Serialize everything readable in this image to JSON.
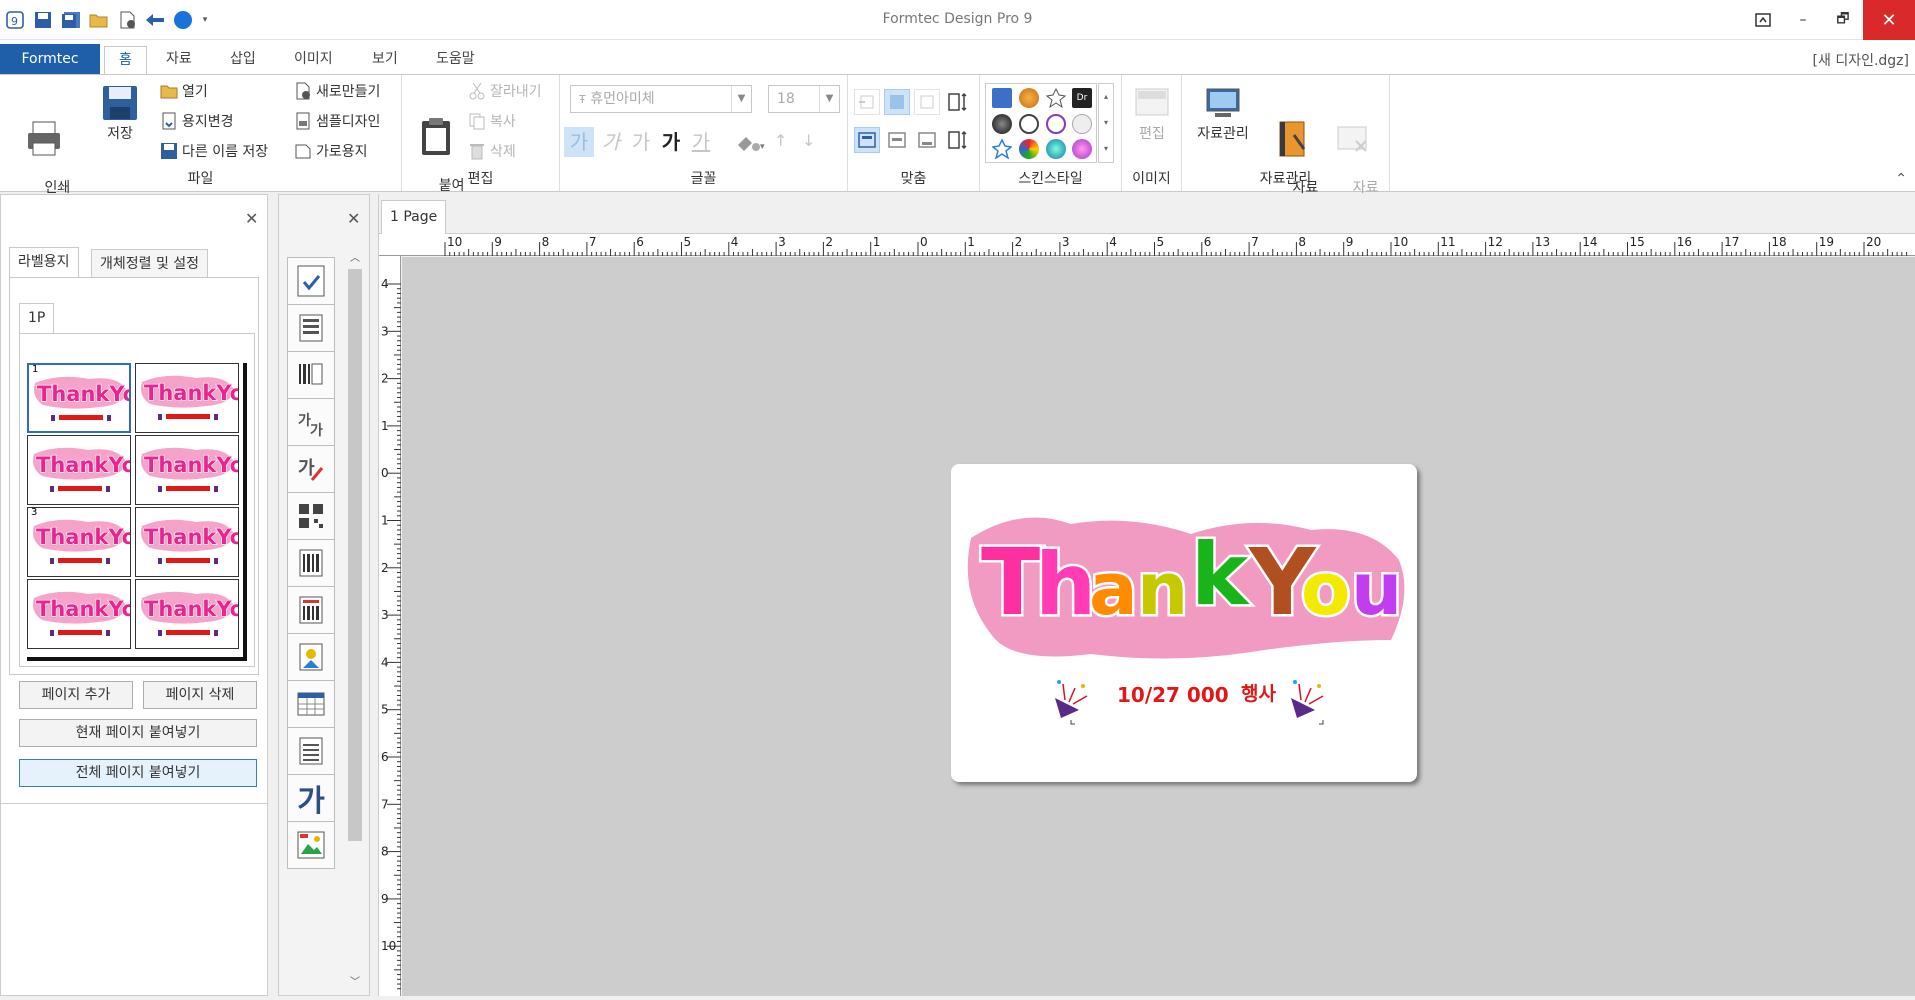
{
  "window": {
    "title": "Formtec Design Pro 9",
    "document_name": "[새 디자인.dgz]",
    "buttons": {
      "restore_icon": "ribbon-display-icon",
      "minimize": "–",
      "maximize": "🗗",
      "close": "✕"
    }
  },
  "menu": {
    "formtec_tab": "Formtec",
    "tabs": [
      "홈",
      "자료",
      "삽입",
      "이미지",
      "보기",
      "도움말"
    ],
    "active_tab": "홈"
  },
  "ribbon": {
    "file": {
      "group_label": "파일",
      "print_preview": "인쇄\n미리보기",
      "save": "저장",
      "open": "열기",
      "change_paper": "용지변경",
      "save_as": "다른 이름 저장",
      "new": "새로만들기",
      "sample_design": "샘플디자인",
      "landscape": "가로용지"
    },
    "edit": {
      "group_label": "편집",
      "paste": "붙여\n넣기",
      "cut": "잘라내기",
      "copy": "복사",
      "delete": "삭제"
    },
    "font": {
      "group_label": "글꼴",
      "font_name": "휴먼아미체",
      "font_size": "18",
      "style_glyph": "가"
    },
    "align": {
      "group_label": "맞춤"
    },
    "skin": {
      "group_label": "스킨스타일"
    },
    "image": {
      "group_label": "이미지",
      "edit": "편집"
    },
    "data": {
      "group_label": "자료관리",
      "manage": "자료관리",
      "wizard": "자료\n마법사",
      "close": "자료\n닫기"
    },
    "colors": {
      "accent": "#1f5ea8",
      "close": "#d9292a"
    }
  },
  "left_panel": {
    "close": "✕",
    "tabs": [
      "라벨용지",
      "개체정렬 및 설정"
    ],
    "page_tab": "1P",
    "thumb_numbers": [
      "1",
      "3"
    ],
    "thumb_text": "ThankYou",
    "buttons": {
      "add_page": "페이지 추가",
      "delete_page": "페이지 삭제",
      "paste_current": "현재 페이지 붙여넣기",
      "paste_all": "전체 페이지 붙여넣기"
    }
  },
  "tool_panel": {
    "close": "✕",
    "tools": [
      "checkbox-icon",
      "text-block-icon",
      "barcode-text-icon",
      "font-art-icon",
      "text-edit-icon",
      "qr-code-icon",
      "barcode-icon",
      "barcode-2-icon",
      "image-icon",
      "table-icon",
      "document-icon",
      "hangul-text-icon",
      "picture-icon"
    ],
    "hangul_tool_glyph": "가"
  },
  "canvas": {
    "page_tab": "1 Page",
    "ruler_top": [
      "10",
      "9",
      "8",
      "7",
      "6",
      "5",
      "4",
      "3",
      "2",
      "1",
      "0",
      "1",
      "2",
      "3",
      "4",
      "5",
      "6",
      "7",
      "8",
      "9",
      "10",
      "11",
      "12",
      "13",
      "14",
      "15",
      "16",
      "17",
      "18",
      "19",
      "20"
    ],
    "ruler_left": [
      "4",
      "3",
      "2",
      "1",
      "0",
      "1",
      "2",
      "3",
      "4",
      "5",
      "6",
      "7",
      "8",
      "9",
      "10"
    ],
    "label": {
      "title_letters": [
        "T",
        "h",
        "a",
        "n",
        "k",
        "Y",
        "o",
        "u"
      ],
      "event_text": "10/27 000",
      "event_word": "행사"
    }
  }
}
